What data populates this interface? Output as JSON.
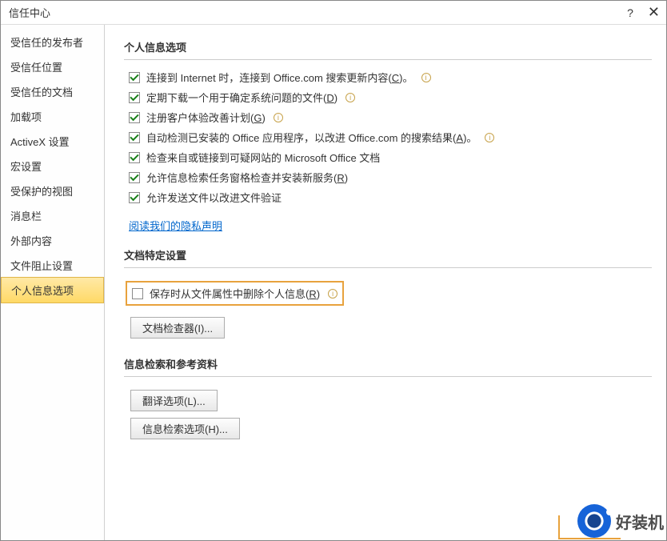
{
  "title": "信任中心",
  "titlebar": {
    "help": "?",
    "close": "✕"
  },
  "sidebar": {
    "items": [
      "受信任的发布者",
      "受信任位置",
      "受信任的文档",
      "加载项",
      "ActiveX 设置",
      "宏设置",
      "受保护的视图",
      "消息栏",
      "外部内容",
      "文件阻止设置",
      "个人信息选项"
    ],
    "active_index": 10
  },
  "sections": {
    "personal": {
      "header": "个人信息选项",
      "options": [
        {
          "label_pre": "连接到 Internet 时，连接到 Office.com 搜索更新内容(",
          "key": "C",
          "label_post": ")。",
          "info": true,
          "checked": true
        },
        {
          "label_pre": "定期下载一个用于确定系统问题的文件(",
          "key": "D",
          "label_post": ")",
          "info": true,
          "checked": true
        },
        {
          "label_pre": "注册客户体验改善计划(",
          "key": "G",
          "label_post": ")",
          "info": true,
          "checked": true
        },
        {
          "label_pre": "自动检测已安装的 Office 应用程序，以改进 Office.com 的搜索结果(",
          "key": "A",
          "label_post": ")。",
          "info": true,
          "checked": true
        },
        {
          "label_pre": "检查来自或链接到可疑网站的 Microsoft Office 文档",
          "key": "",
          "label_post": "",
          "info": false,
          "checked": true
        },
        {
          "label_pre": "允许信息检索任务窗格检查并安装新服务(",
          "key": "R",
          "label_post": ")",
          "info": false,
          "checked": true
        },
        {
          "label_pre": "允许发送文件以改进文件验证",
          "key": "",
          "label_post": "",
          "info": false,
          "checked": true
        }
      ],
      "privacy_link": "阅读我们的隐私声明"
    },
    "docspec": {
      "header": "文档特定设置",
      "remove_option": {
        "label_pre": "保存时从文件属性中删除个人信息(",
        "key": "R",
        "label_post": ")",
        "info": true,
        "checked": false
      },
      "inspector_btn": "文档检查器(I)..."
    },
    "research": {
      "header": "信息检索和参考资料",
      "translate_btn": "翻译选项(L)...",
      "search_btn": "信息检索选项(H)..."
    }
  },
  "watermark": "好装机"
}
